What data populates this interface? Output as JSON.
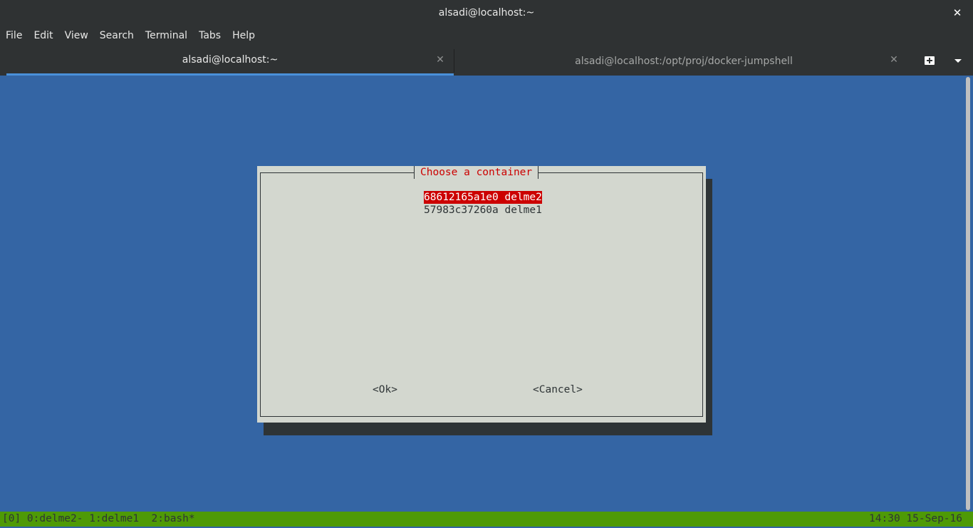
{
  "window": {
    "title": "alsadi@localhost:~",
    "close_icon": "close-icon"
  },
  "menubar": {
    "items": [
      "File",
      "Edit",
      "View",
      "Search",
      "Terminal",
      "Tabs",
      "Help"
    ]
  },
  "tabs": [
    {
      "label": "alsadi@localhost:~",
      "active": true
    },
    {
      "label": "alsadi@localhost:/opt/proj/docker-jumpshell",
      "active": false
    }
  ],
  "dialog": {
    "title": "Choose a container",
    "items": [
      {
        "label": "68612165a1e0 delme2",
        "selected": true
      },
      {
        "label": "57983c37260a delme1",
        "selected": false
      }
    ],
    "ok_label": "<Ok>",
    "cancel_label": "<Cancel>"
  },
  "statusbar": {
    "left": "[0] 0:delme2- 1:delme1  2:bash*",
    "right": "14:30 15-Sep-16"
  },
  "colors": {
    "terminal_bg": "#3465a4",
    "dialog_bg": "#d3d7cf",
    "accent_red": "#cc0000",
    "status_green": "#4e9a06"
  }
}
